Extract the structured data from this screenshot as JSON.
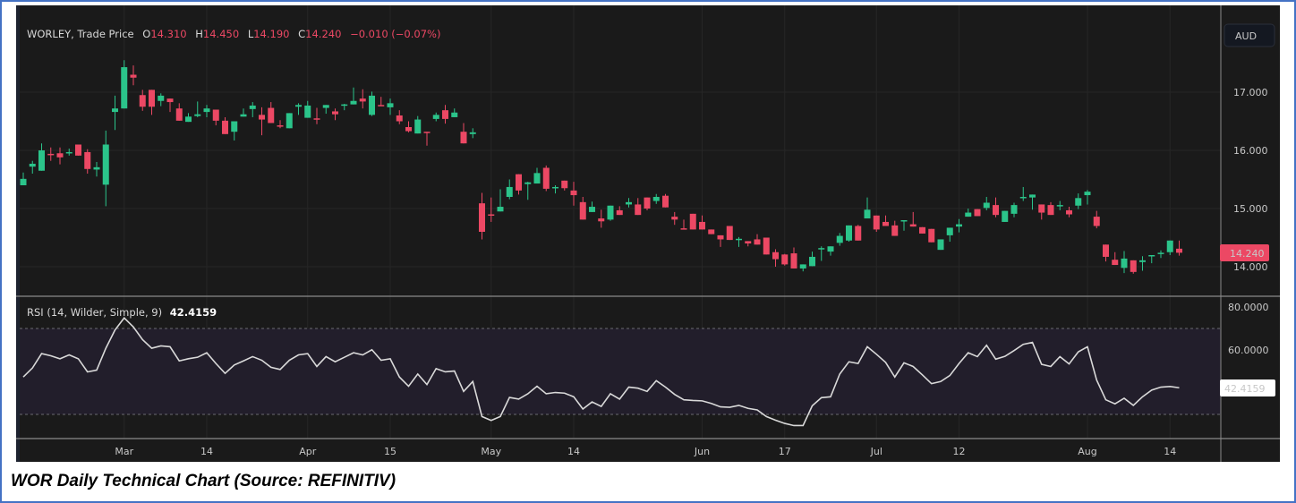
{
  "header": {
    "symbol": "WORLEY, Trade Price",
    "o_label": "O",
    "o": "14.310",
    "h_label": "H",
    "h": "14.450",
    "l_label": "L",
    "l": "14.190",
    "c_label": "C",
    "c": "14.240",
    "change": "−0.010 (−0.07%)"
  },
  "currency": "AUD",
  "last_price_tag": "14.240",
  "rsi": {
    "label": "RSI (14, Wilder, Simple, 9)",
    "value": "42.4159",
    "tag": "42.4159"
  },
  "caption": "WOR Daily Technical Chart (Source: REFINITIV)",
  "colors": {
    "up": "#2bc48a",
    "down": "#ec4864",
    "rsi_line": "#d9d9d9",
    "rsi_band": "#221e2b",
    "background": "#1a1a1a"
  },
  "chart_data": [
    {
      "type": "candlestick",
      "title": "WORLEY, Trade Price",
      "ylabel": "AUD",
      "ylim": [
        13.7,
        17.7
      ],
      "yticks": [
        "17.000",
        "16.000",
        "15.000",
        "14.000"
      ],
      "ytick_values": [
        17,
        16,
        15,
        14
      ],
      "xticks": [
        "Mar",
        "14",
        "Apr",
        "15",
        "May",
        "14",
        "Jun",
        "17",
        "Jul",
        "12",
        "Aug",
        "14"
      ],
      "xtick_index": [
        11,
        20,
        31,
        40,
        51,
        60,
        74,
        83,
        93,
        102,
        116,
        125
      ],
      "ohlc_order": [
        "open",
        "high",
        "low",
        "close"
      ],
      "candles": [
        [
          15.4,
          15.62,
          15.4,
          15.51
        ],
        [
          15.72,
          15.82,
          15.6,
          15.77
        ],
        [
          15.65,
          16.12,
          15.65,
          16.0
        ],
        [
          15.94,
          16.05,
          15.82,
          15.92
        ],
        [
          15.95,
          16.05,
          15.76,
          15.88
        ],
        [
          15.96,
          16.03,
          15.91,
          15.97
        ],
        [
          16.1,
          16.1,
          15.91,
          15.91
        ],
        [
          15.97,
          16.02,
          15.6,
          15.68
        ],
        [
          15.67,
          15.8,
          15.55,
          15.71
        ],
        [
          15.41,
          16.34,
          15.04,
          16.1
        ],
        [
          16.66,
          16.94,
          16.35,
          16.72
        ],
        [
          16.72,
          17.55,
          16.72,
          17.43
        ],
        [
          17.3,
          17.46,
          17.12,
          17.25
        ],
        [
          16.95,
          17.04,
          16.68,
          16.75
        ],
        [
          17.04,
          17.04,
          16.61,
          16.75
        ],
        [
          16.85,
          16.98,
          16.76,
          16.94
        ],
        [
          16.89,
          16.89,
          16.66,
          16.83
        ],
        [
          16.72,
          16.81,
          16.51,
          16.51
        ],
        [
          16.49,
          16.64,
          16.49,
          16.58
        ],
        [
          16.59,
          16.84,
          16.57,
          16.62
        ],
        [
          16.66,
          16.78,
          16.57,
          16.72
        ],
        [
          16.7,
          16.7,
          16.43,
          16.51
        ],
        [
          16.51,
          16.57,
          16.28,
          16.28
        ],
        [
          16.32,
          16.5,
          16.17,
          16.5
        ],
        [
          16.58,
          16.72,
          16.58,
          16.62
        ],
        [
          16.71,
          16.83,
          16.57,
          16.77
        ],
        [
          16.61,
          16.74,
          16.26,
          16.53
        ],
        [
          16.73,
          16.83,
          16.47,
          16.47
        ],
        [
          16.43,
          16.52,
          16.38,
          16.41
        ],
        [
          16.38,
          16.64,
          16.38,
          16.64
        ],
        [
          16.75,
          16.81,
          16.61,
          16.78
        ],
        [
          16.56,
          16.85,
          16.56,
          16.77
        ],
        [
          16.55,
          16.73,
          16.45,
          16.53
        ],
        [
          16.73,
          16.78,
          16.63,
          16.78
        ],
        [
          16.67,
          16.72,
          16.52,
          16.62
        ],
        [
          16.77,
          16.8,
          16.69,
          16.79
        ],
        [
          16.79,
          17.08,
          16.79,
          16.85
        ],
        [
          16.89,
          17.05,
          16.72,
          16.84
        ],
        [
          16.61,
          17.01,
          16.59,
          16.94
        ],
        [
          16.78,
          16.92,
          16.76,
          16.76
        ],
        [
          16.74,
          16.89,
          16.61,
          16.81
        ],
        [
          16.6,
          16.69,
          16.45,
          16.5
        ],
        [
          16.4,
          16.5,
          16.31,
          16.33
        ],
        [
          16.29,
          16.59,
          16.29,
          16.53
        ],
        [
          16.32,
          16.32,
          16.08,
          16.3
        ],
        [
          16.54,
          16.65,
          16.5,
          16.61
        ],
        [
          16.69,
          16.78,
          16.46,
          16.54
        ],
        [
          16.57,
          16.72,
          16.57,
          16.65
        ],
        [
          16.32,
          16.47,
          16.12,
          16.12
        ],
        [
          16.28,
          16.38,
          16.21,
          16.31
        ],
        [
          15.09,
          15.27,
          14.47,
          14.6
        ],
        [
          14.9,
          15.19,
          14.77,
          14.88
        ],
        [
          14.95,
          15.33,
          14.95,
          15.03
        ],
        [
          15.2,
          15.5,
          15.16,
          15.37
        ],
        [
          15.59,
          15.59,
          15.24,
          15.31
        ],
        [
          15.42,
          15.46,
          15.15,
          15.45
        ],
        [
          15.43,
          15.7,
          15.43,
          15.61
        ],
        [
          15.7,
          15.74,
          15.3,
          15.34
        ],
        [
          15.36,
          15.4,
          15.26,
          15.37
        ],
        [
          15.48,
          15.48,
          15.31,
          15.35
        ],
        [
          15.31,
          15.46,
          15.05,
          15.23
        ],
        [
          15.11,
          15.2,
          14.81,
          14.81
        ],
        [
          14.94,
          15.12,
          14.94,
          15.03
        ],
        [
          14.83,
          14.98,
          14.67,
          14.78
        ],
        [
          14.81,
          15.05,
          14.79,
          15.05
        ],
        [
          14.97,
          15.04,
          14.89,
          14.89
        ],
        [
          15.07,
          15.18,
          15.02,
          15.11
        ],
        [
          15.07,
          15.18,
          14.89,
          14.89
        ],
        [
          15.19,
          15.19,
          14.97,
          15.0
        ],
        [
          15.13,
          15.25,
          15.08,
          15.2
        ],
        [
          15.22,
          15.25,
          15.02,
          15.02
        ],
        [
          14.86,
          14.94,
          14.72,
          14.81
        ],
        [
          14.66,
          14.81,
          14.65,
          14.65
        ],
        [
          14.91,
          14.91,
          14.64,
          14.64
        ],
        [
          14.77,
          14.88,
          14.64,
          14.64
        ],
        [
          14.64,
          14.64,
          14.56,
          14.56
        ],
        [
          14.54,
          14.54,
          14.34,
          14.47
        ],
        [
          14.7,
          14.7,
          14.46,
          14.46
        ],
        [
          14.47,
          14.51,
          14.34,
          14.48
        ],
        [
          14.44,
          14.44,
          14.35,
          14.4
        ],
        [
          14.47,
          14.56,
          14.38,
          14.38
        ],
        [
          14.5,
          14.5,
          14.21,
          14.21
        ],
        [
          14.25,
          14.3,
          14.0,
          14.13
        ],
        [
          14.21,
          14.22,
          14.02,
          14.04
        ],
        [
          14.23,
          14.33,
          13.97,
          13.97
        ],
        [
          13.97,
          14.04,
          13.92,
          14.04
        ],
        [
          14.01,
          14.26,
          14.01,
          14.17
        ],
        [
          14.31,
          14.35,
          14.1,
          14.32
        ],
        [
          14.26,
          14.35,
          14.19,
          14.35
        ],
        [
          14.41,
          14.58,
          14.36,
          14.53
        ],
        [
          14.45,
          14.71,
          14.43,
          14.71
        ],
        [
          14.7,
          14.72,
          14.45,
          14.45
        ],
        [
          14.83,
          15.19,
          14.83,
          14.98
        ],
        [
          14.88,
          14.88,
          14.6,
          14.64
        ],
        [
          14.77,
          14.88,
          14.7,
          14.7
        ],
        [
          14.71,
          14.79,
          14.53,
          14.53
        ],
        [
          14.79,
          14.8,
          14.62,
          14.8
        ],
        [
          14.73,
          14.94,
          14.69,
          14.69
        ],
        [
          14.68,
          14.68,
          14.57,
          14.57
        ],
        [
          14.65,
          14.65,
          14.42,
          14.42
        ],
        [
          14.29,
          14.47,
          14.29,
          14.47
        ],
        [
          14.54,
          14.67,
          14.43,
          14.67
        ],
        [
          14.69,
          14.82,
          14.59,
          14.73
        ],
        [
          14.86,
          15.0,
          14.86,
          14.93
        ],
        [
          14.99,
          14.99,
          14.87,
          14.87
        ],
        [
          15.01,
          15.2,
          14.97,
          15.1
        ],
        [
          15.06,
          15.19,
          14.85,
          14.89
        ],
        [
          14.77,
          14.96,
          14.77,
          14.96
        ],
        [
          14.91,
          15.1,
          14.85,
          15.06
        ],
        [
          15.19,
          15.37,
          15.13,
          15.2
        ],
        [
          15.19,
          15.24,
          14.98,
          15.24
        ],
        [
          15.07,
          15.07,
          14.81,
          14.93
        ],
        [
          15.06,
          15.11,
          14.89,
          14.89
        ],
        [
          15.05,
          15.13,
          14.97,
          15.06
        ],
        [
          14.97,
          15.03,
          14.85,
          14.9
        ],
        [
          15.05,
          15.26,
          14.99,
          15.18
        ],
        [
          15.23,
          15.32,
          15.07,
          15.29
        ],
        [
          14.86,
          14.96,
          14.66,
          14.7
        ],
        [
          14.38,
          14.38,
          14.09,
          14.17
        ],
        [
          14.12,
          14.25,
          14.03,
          14.03
        ],
        [
          13.98,
          14.27,
          13.89,
          14.14
        ],
        [
          14.11,
          14.11,
          13.88,
          13.91
        ],
        [
          14.08,
          14.18,
          13.93,
          14.11
        ],
        [
          14.19,
          14.2,
          14.06,
          14.2
        ],
        [
          14.23,
          14.28,
          14.15,
          14.24
        ],
        [
          14.25,
          14.45,
          14.2,
          14.45
        ],
        [
          14.31,
          14.45,
          14.19,
          14.24
        ]
      ]
    },
    {
      "type": "line",
      "title": "RSI (14, Wilder, Simple, 9)",
      "ylim": [
        20,
        80
      ],
      "yticks": [
        "80.0000",
        "60.0000"
      ],
      "ytick_values": [
        80,
        60
      ],
      "bands": {
        "upper": 70,
        "lower": 30
      },
      "grid_values": [
        60,
        40
      ],
      "values": [
        47.4,
        51.6,
        58.3,
        57.3,
        55.9,
        57.7,
        55.9,
        49.8,
        50.6,
        60.8,
        69.3,
        74.9,
        70.7,
        64.8,
        60.8,
        61.9,
        61.5,
        54.9,
        55.9,
        56.6,
        58.7,
        53.7,
        49.1,
        53.0,
        54.9,
        56.9,
        55.2,
        51.9,
        50.9,
        55.2,
        57.7,
        58.3,
        52.3,
        56.9,
        54.5,
        56.6,
        58.7,
        57.7,
        60.1,
        55.2,
        55.9,
        47.4,
        43.1,
        48.8,
        43.9,
        51.3,
        49.8,
        50.2,
        40.7,
        45.3,
        29.0,
        27.2,
        29.0,
        37.9,
        37.1,
        39.6,
        43.1,
        39.6,
        40.2,
        39.9,
        38.2,
        32.5,
        35.8,
        33.7,
        39.6,
        37.1,
        42.7,
        42.2,
        40.7,
        45.7,
        42.7,
        39.3,
        36.8,
        36.5,
        36.3,
        35.1,
        33.5,
        33.3,
        34.2,
        32.8,
        32.1,
        29.0,
        27.3,
        25.8,
        24.8,
        24.8,
        34.0,
        37.8,
        38.2,
        48.8,
        54.5,
        53.7,
        61.5,
        58.0,
        54.2,
        47.4,
        54.0,
        52.3,
        48.4,
        44.3,
        45.3,
        48.1,
        53.7,
        58.7,
        56.9,
        62.2,
        55.7,
        57.0,
        59.7,
        62.6,
        63.5,
        53.3,
        52.3,
        56.9,
        53.5,
        59.1,
        61.5,
        46.0,
        36.8,
        34.9,
        37.5,
        34.2,
        38.2,
        41.3,
        42.7,
        43.0,
        42.4
      ]
    }
  ]
}
